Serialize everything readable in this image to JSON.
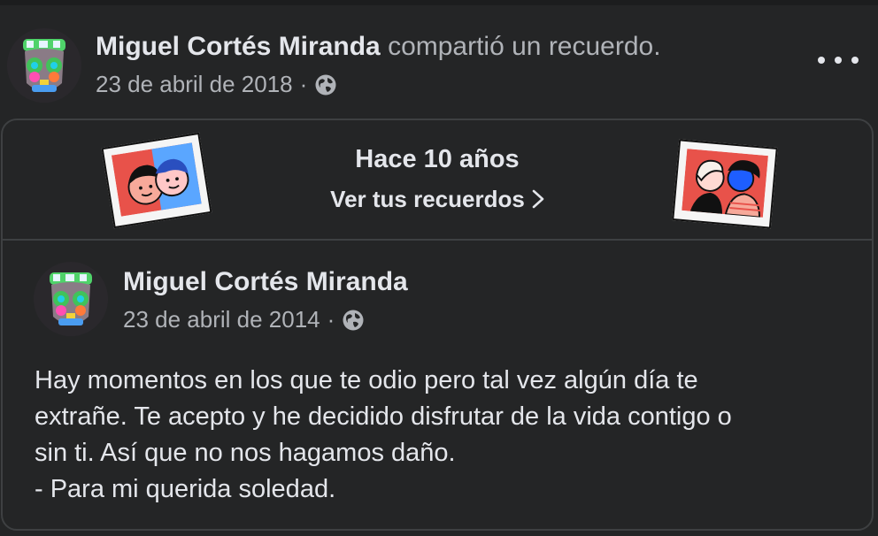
{
  "post": {
    "author": "Miguel Cortés Miranda",
    "action": "compartió un recuerdo.",
    "date": "23 de abril de 2018",
    "separator": "·",
    "privacy_icon": "globe-icon",
    "menu_icon": "more-horizontal-icon"
  },
  "memory": {
    "title": "Hace 10 años",
    "link_label": "Ver tus recuerdos",
    "link_icon": "chevron-right-icon"
  },
  "original_post": {
    "author": "Miguel Cortés Miranda",
    "date": "23 de abril de 2014",
    "separator": "·",
    "privacy_icon": "globe-icon",
    "text_lines": [
      "Hay momentos en los que te odio pero tal vez algún día te",
      "extrañe. Te acepto y he decidido disfrutar de la vida contigo o",
      "sin ti. Así que no nos hagamos daño.",
      "- Para mi querida soledad."
    ]
  },
  "colors": {
    "background": "#242526",
    "primary_text": "#e4e6eb",
    "secondary_text": "#b0b3b8",
    "border": "#3e4042"
  }
}
